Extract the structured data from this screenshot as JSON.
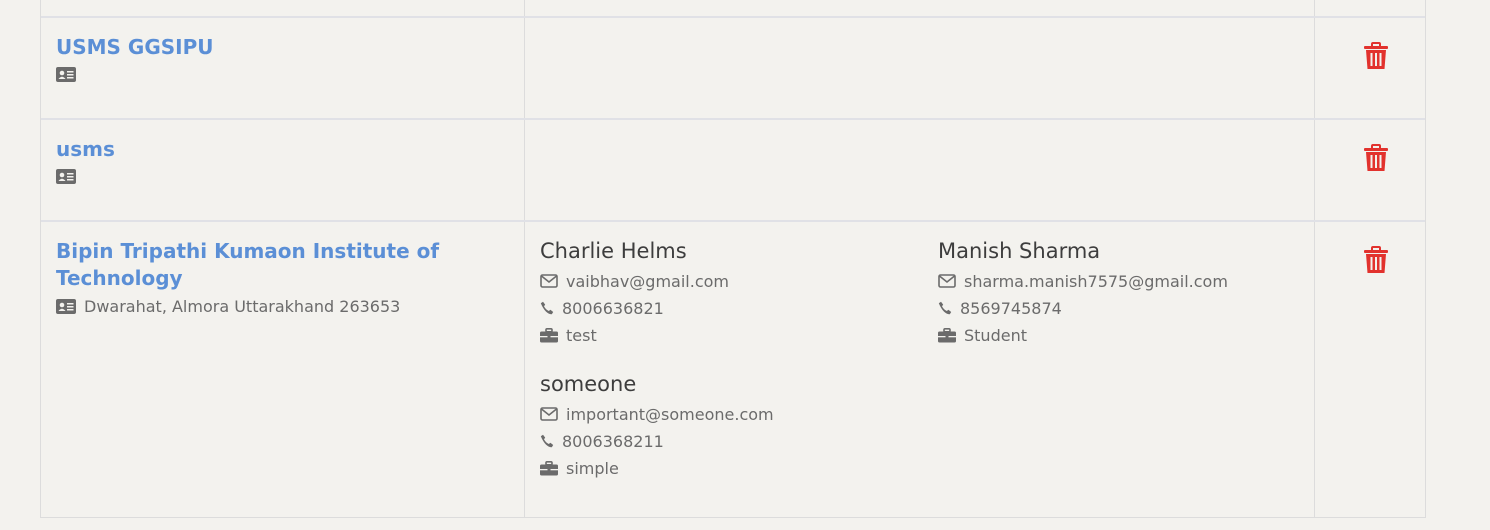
{
  "institutions": [
    {
      "name": "USMS GGSIPU",
      "address": ""
    },
    {
      "name": "usms",
      "address": ""
    },
    {
      "name_line1": "Bipin Tripathi Kumaon Institute of",
      "name_line2": "Technology",
      "address": "Dwarahat, Almora Uttarakhand 263653",
      "contacts": [
        {
          "name": "Charlie Helms",
          "email": "vaibhav@gmail.com",
          "phone": "8006636821",
          "role": "test"
        },
        {
          "name": "Manish Sharma",
          "email": "sharma.manish7575@gmail.com",
          "phone": "8569745874",
          "role": "Student"
        },
        {
          "name": "someone",
          "email": "important@someone.com",
          "phone": "8006368211",
          "role": "simple"
        }
      ]
    }
  ],
  "icons": {
    "address": "id-card-icon",
    "email": "envelope-icon",
    "phone": "phone-icon",
    "role": "briefcase-icon",
    "delete": "trash-icon"
  },
  "colors": {
    "link": "#5b8fd6",
    "delete": "#e2322d",
    "background": "#f3f2ee",
    "border": "#dcdcdc"
  }
}
